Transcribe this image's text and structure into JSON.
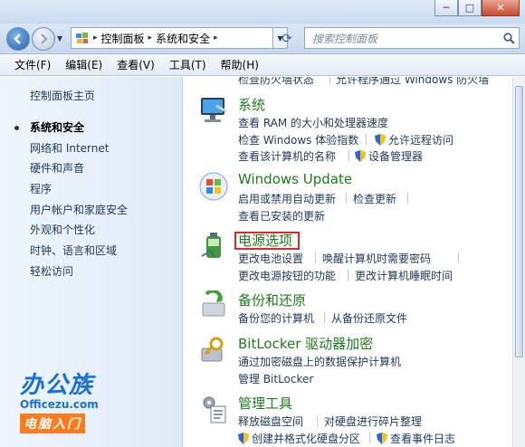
{
  "window": {
    "minimize": "─",
    "maximize": "□",
    "close": "✕"
  },
  "address": {
    "crumb1": "控制面板",
    "crumb2": "系统和安全"
  },
  "search": {
    "placeholder": "搜索控制面板"
  },
  "menu": [
    "文件(F)",
    "编辑(E)",
    "查看(V)",
    "工具(T)",
    "帮助(H)"
  ],
  "sidebar": {
    "home": "控制面板主页",
    "items": [
      {
        "label": "系统和安全",
        "active": true
      },
      {
        "label": "网络和 Internet"
      },
      {
        "label": "硬件和声音"
      },
      {
        "label": "程序"
      },
      {
        "label": "用户帐户和家庭安全"
      },
      {
        "label": "外观和个性化"
      },
      {
        "label": "时钟、语言和区域"
      },
      {
        "label": "轻松访问"
      }
    ]
  },
  "logo": {
    "main": "办公族",
    "site": "Officezu.com",
    "sub": "电脑入门"
  },
  "content": {
    "top_links": {
      "l1": "检查防火墙状态",
      "l2": "允许程序通过 Windows 防火墙"
    },
    "system": {
      "title": "系统",
      "l1": "查看 RAM 的大小和处理器速度",
      "l2": "检查 Windows 体验指数",
      "l3": "允许远程访问",
      "l4": "查看该计算机的名称",
      "l5": "设备管理器"
    },
    "windows_update": {
      "title": "Windows Update",
      "l1": "启用或禁用自动更新",
      "l2": "检查更新",
      "l3": "查看已安装的更新"
    },
    "power": {
      "title": "电源选项",
      "l1": "更改电池设置",
      "l2": "唤醒计算机时需要密码",
      "l3": "更改电源按钮的功能",
      "l4": "更改计算机睡眠时间"
    },
    "backup": {
      "title": "备份和还原",
      "l1": "备份您的计算机",
      "l2": "从备份还原文件"
    },
    "bitlocker": {
      "title": "BitLocker 驱动器加密",
      "l1": "通过加密磁盘上的数据保护计算机",
      "l2": "管理 BitLocker"
    },
    "admin": {
      "title": "管理工具",
      "l1": "释放磁盘空间",
      "l2": "对硬盘进行碎片整理",
      "l3": "创建并格式化硬盘分区",
      "l4": "查看事件日志"
    }
  }
}
